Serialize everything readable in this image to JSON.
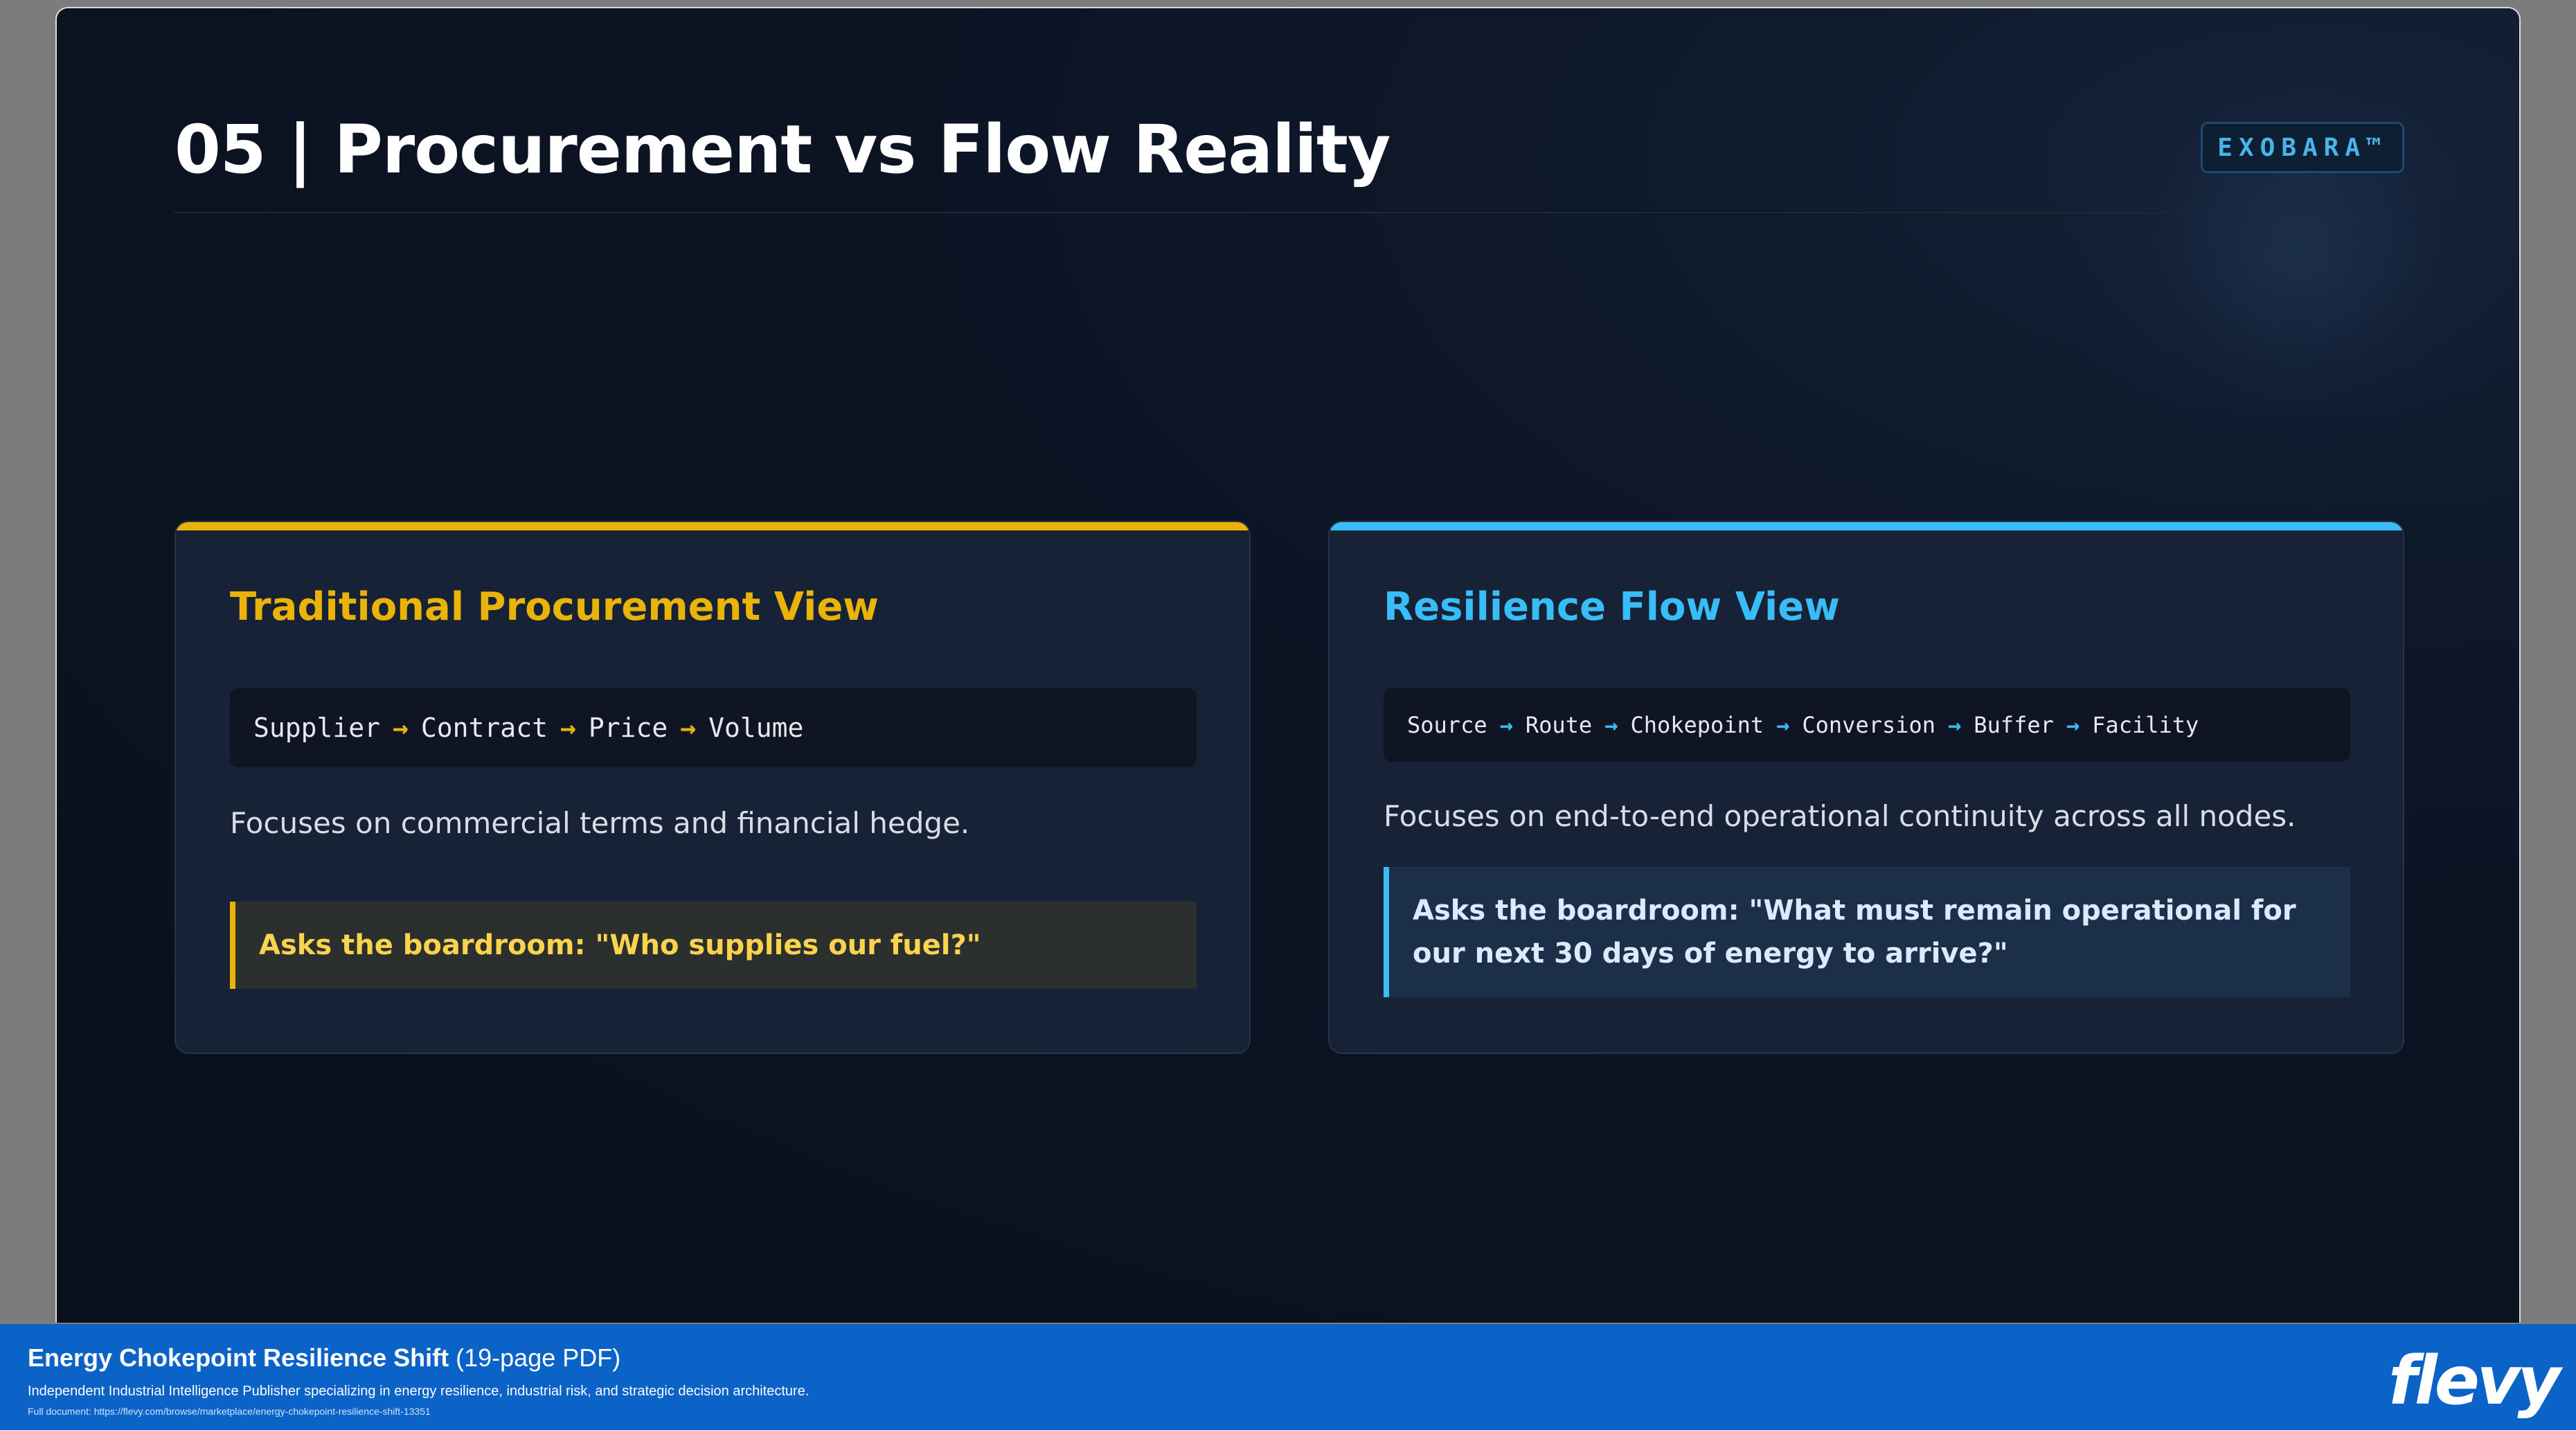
{
  "slide": {
    "title": "05 | Procurement vs Flow Reality",
    "brand": "EXOBARA™"
  },
  "cards": {
    "left": {
      "title": "Traditional Procurement View",
      "flow": [
        "Supplier",
        "Contract",
        "Price",
        "Volume"
      ],
      "arrow": "→",
      "description": "Focuses on commercial terms and financial hedge.",
      "quote": "Asks the boardroom: \"Who supplies our fuel?\""
    },
    "right": {
      "title": "Resilience Flow View",
      "flow": [
        "Source",
        "Route",
        "Chokepoint",
        "Conversion",
        "Buffer",
        "Facility"
      ],
      "arrow": "→",
      "description": "Focuses on end-to-end operational continuity across all nodes.",
      "quote": "Asks the boardroom: \"What must remain operational for our next 30 days of energy to arrive?\""
    }
  },
  "colors": {
    "traditional_accent": "#eab308",
    "resilience_accent": "#38bdf8",
    "footer_bg": "#0b63c8"
  },
  "footer": {
    "title": "Energy Chokepoint Resilience Shift",
    "pages": "(19-page PDF)",
    "description": "Independent Industrial Intelligence Publisher specializing in energy resilience, industrial risk, and strategic decision architecture.",
    "link": "Full document: https://flevy.com/browse/marketplace/energy-chokepoint-resilience-shift-13351",
    "logo": "flevy"
  }
}
